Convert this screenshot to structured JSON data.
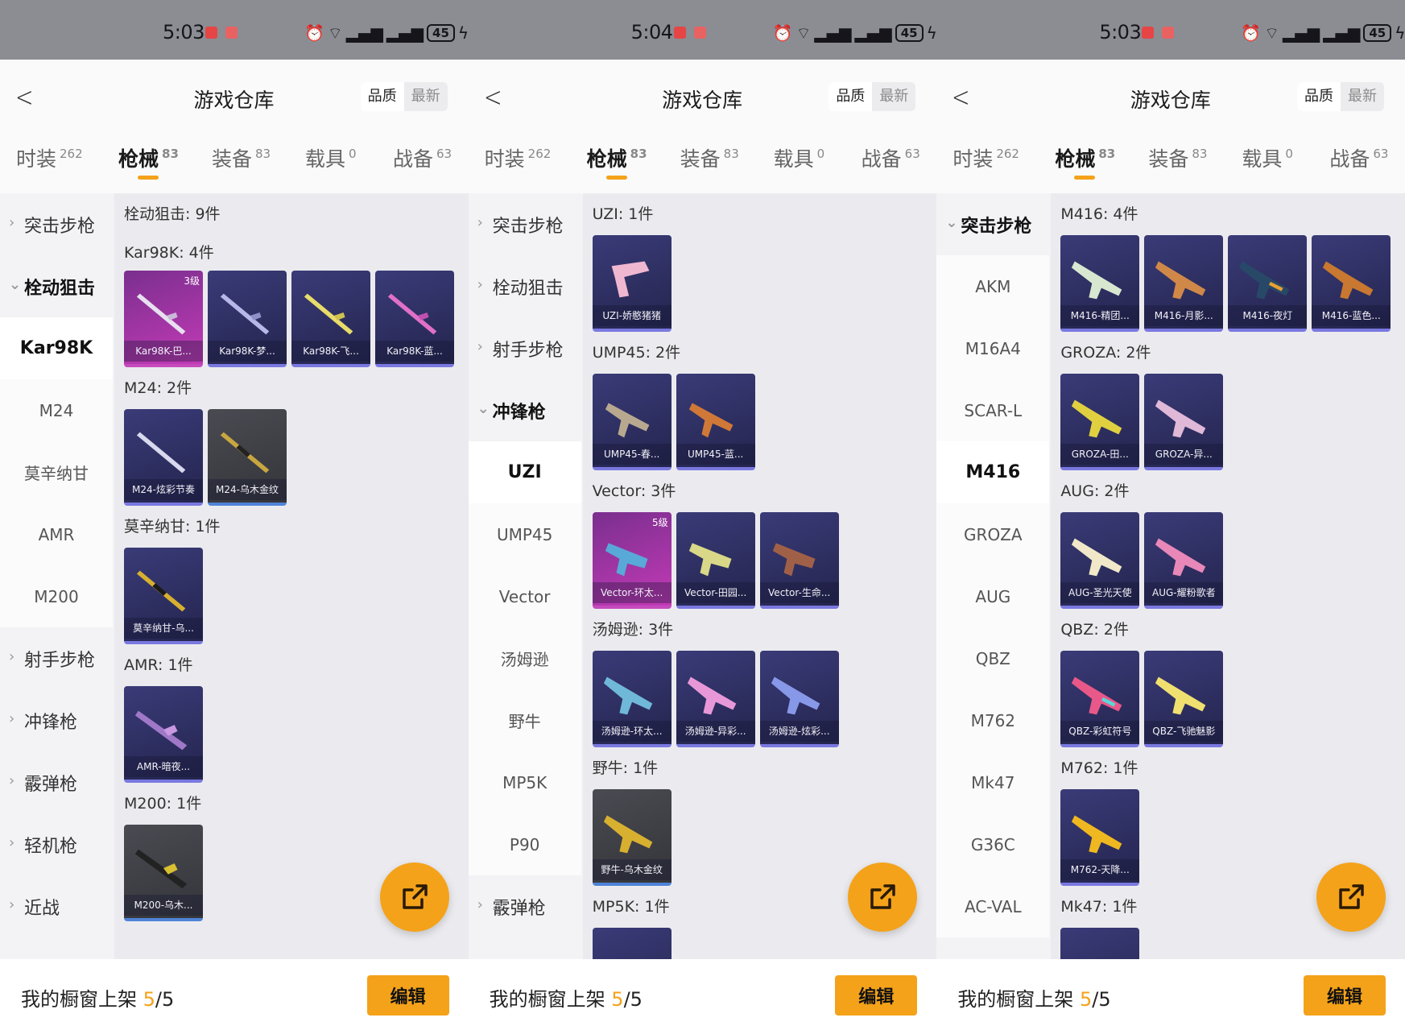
{
  "status": {
    "battery": "45"
  },
  "panels": [
    {
      "time": "5:03",
      "title": "游戏仓库",
      "sort": [
        "品质",
        "最新"
      ],
      "tabs": [
        {
          "label": "时装",
          "count": "262"
        },
        {
          "label": "枪械",
          "count": "83"
        },
        {
          "label": "装备",
          "count": "83"
        },
        {
          "label": "载具",
          "count": "0"
        },
        {
          "label": "战备",
          "count": "63"
        }
      ],
      "sidebar": [
        "突击步枪",
        "栓动狙击",
        "Kar98K",
        "M24",
        "莫辛纳甘",
        "AMR",
        "M200",
        "射手步枪",
        "冲锋枪",
        "霰弹枪",
        "轻机枪",
        "近战"
      ],
      "summary": "栓动狙击: 9件",
      "sections": [
        {
          "title": "Kar98K: 4件",
          "items": [
            {
              "name": "Kar98K-巴...",
              "level": "3级",
              "tone": "pink"
            },
            {
              "name": "Kar98K-梦...",
              "level": "",
              "tone": "blue"
            },
            {
              "name": "Kar98K-飞...",
              "level": "",
              "tone": "blue"
            },
            {
              "name": "Kar98K-蓝...",
              "level": "",
              "tone": "blue"
            }
          ]
        },
        {
          "title": "M24: 2件",
          "items": [
            {
              "name": "M24-炫彩节奏",
              "level": "",
              "tone": "blue"
            },
            {
              "name": "M24-乌木金纹",
              "level": "",
              "tone": "gray"
            }
          ]
        },
        {
          "title": "莫辛纳甘: 1件",
          "items": [
            {
              "name": "莫辛纳甘-乌...",
              "level": "",
              "tone": "blue"
            }
          ]
        },
        {
          "title": "AMR: 1件",
          "items": [
            {
              "name": "AMR-暗夜...",
              "level": "",
              "tone": "blue"
            }
          ]
        },
        {
          "title": "M200: 1件",
          "items": [
            {
              "name": "M200-乌木...",
              "level": "",
              "tone": "gray"
            }
          ]
        }
      ],
      "footer": {
        "label": "我的橱窗上架",
        "count": "5",
        "total": "/5",
        "edit": "编辑"
      }
    },
    {
      "time": "5:04",
      "title": "游戏仓库",
      "sort": [
        "品质",
        "最新"
      ],
      "tabs": [
        {
          "label": "时装",
          "count": "262"
        },
        {
          "label": "枪械",
          "count": "83"
        },
        {
          "label": "装备",
          "count": "83"
        },
        {
          "label": "载具",
          "count": "0"
        },
        {
          "label": "战备",
          "count": "63"
        }
      ],
      "sidebar": [
        "突击步枪",
        "栓动狙击",
        "射手步枪",
        "冲锋枪",
        "UZI",
        "UMP45",
        "Vector",
        "汤姆逊",
        "野牛",
        "MP5K",
        "P90",
        "霰弹枪"
      ],
      "summary": "",
      "sections": [
        {
          "title": "UZI: 1件",
          "items": [
            {
              "name": "UZI-娇憨猪猪",
              "level": "",
              "tone": "blue"
            }
          ]
        },
        {
          "title": "UMP45: 2件",
          "items": [
            {
              "name": "UMP45-春...",
              "level": "",
              "tone": "blue"
            },
            {
              "name": "UMP45-蓝...",
              "level": "",
              "tone": "blue"
            }
          ]
        },
        {
          "title": "Vector: 3件",
          "items": [
            {
              "name": "Vector-环太...",
              "level": "5级",
              "tone": "pink"
            },
            {
              "name": "Vector-田园...",
              "level": "",
              "tone": "blue"
            },
            {
              "name": "Vector-生命...",
              "level": "",
              "tone": "blue"
            }
          ]
        },
        {
          "title": "汤姆逊: 3件",
          "items": [
            {
              "name": "汤姆逊-环太...",
              "level": "",
              "tone": "blue"
            },
            {
              "name": "汤姆逊-异彩...",
              "level": "",
              "tone": "blue"
            },
            {
              "name": "汤姆逊-炫彩...",
              "level": "",
              "tone": "blue"
            }
          ]
        },
        {
          "title": "野牛: 1件",
          "items": [
            {
              "name": "野牛-乌木金纹",
              "level": "",
              "tone": "gray"
            }
          ]
        },
        {
          "title": "MP5K: 1件",
          "items": [
            {
              "name": "",
              "level": "",
              "tone": "blue"
            }
          ]
        }
      ],
      "footer": {
        "label": "我的橱窗上架",
        "count": "5",
        "total": "/5",
        "edit": "编辑"
      }
    },
    {
      "time": "5:03",
      "title": "游戏仓库",
      "sort": [
        "品质",
        "最新"
      ],
      "tabs": [
        {
          "label": "时装",
          "count": "262"
        },
        {
          "label": "枪械",
          "count": "83"
        },
        {
          "label": "装备",
          "count": "83"
        },
        {
          "label": "载具",
          "count": "0"
        },
        {
          "label": "战备",
          "count": "63"
        }
      ],
      "sidebar": [
        "突击步枪",
        "AKM",
        "M16A4",
        "SCAR-L",
        "M416",
        "GROZA",
        "AUG",
        "QBZ",
        "M762",
        "Mk47",
        "G36C",
        "AC-VAL"
      ],
      "summary": "",
      "sections": [
        {
          "title": "M416: 4件",
          "items": [
            {
              "name": "M416-精团...",
              "level": "",
              "tone": "blue"
            },
            {
              "name": "M416-月影...",
              "level": "",
              "tone": "blue"
            },
            {
              "name": "M416-夜灯",
              "level": "",
              "tone": "blue"
            },
            {
              "name": "M416-蓝色...",
              "level": "",
              "tone": "blue"
            }
          ]
        },
        {
          "title": "GROZA: 2件",
          "items": [
            {
              "name": "GROZA-田...",
              "level": "",
              "tone": "blue"
            },
            {
              "name": "GROZA-异...",
              "level": "",
              "tone": "blue"
            }
          ]
        },
        {
          "title": "AUG: 2件",
          "items": [
            {
              "name": "AUG-圣光天使",
              "level": "",
              "tone": "blue"
            },
            {
              "name": "AUG-耀粉歌者",
              "level": "",
              "tone": "blue"
            }
          ]
        },
        {
          "title": "QBZ: 2件",
          "items": [
            {
              "name": "QBZ-彩虹符号",
              "level": "",
              "tone": "blue"
            },
            {
              "name": "QBZ-飞驰魅影",
              "level": "",
              "tone": "blue"
            }
          ]
        },
        {
          "title": "M762: 1件",
          "items": [
            {
              "name": "M762-天降...",
              "level": "",
              "tone": "blue"
            }
          ]
        },
        {
          "title": "Mk47: 1件",
          "items": [
            {
              "name": "",
              "level": "",
              "tone": "blue"
            }
          ]
        }
      ],
      "footer": {
        "label": "我的橱窗上架",
        "count": "5",
        "total": "/5",
        "edit": "编辑"
      }
    }
  ]
}
